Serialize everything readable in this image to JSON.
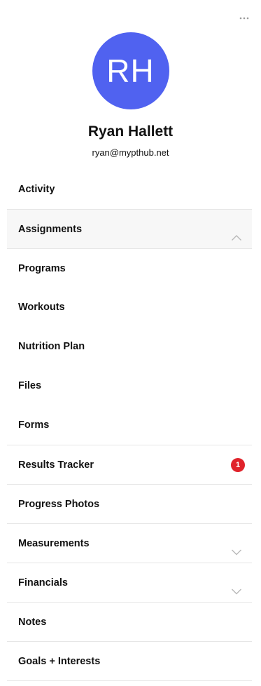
{
  "profile": {
    "initials": "RH",
    "name": "Ryan Hallett",
    "email": "ryan@mypthub.net",
    "avatar_color": "#5062f0"
  },
  "icons": {
    "more": "more-horizontal-icon",
    "chevron_up": "chevron-up-icon",
    "chevron_down": "chevron-down-icon"
  },
  "menu": {
    "items": [
      {
        "label": "Activity"
      },
      {
        "label": "Assignments",
        "expanded": true
      },
      {
        "label": "Programs"
      },
      {
        "label": "Workouts"
      },
      {
        "label": "Nutrition Plan"
      },
      {
        "label": "Files"
      },
      {
        "label": "Forms"
      },
      {
        "label": "Results Tracker",
        "badge": "1"
      },
      {
        "label": "Progress Photos"
      },
      {
        "label": "Measurements",
        "expandable": true
      },
      {
        "label": "Financials",
        "expandable": true
      },
      {
        "label": "Notes"
      },
      {
        "label": "Goals + Interests"
      }
    ]
  },
  "colors": {
    "badge": "#e0232b",
    "active_row": "#f7f7f7",
    "divider": "#e6e6e6"
  }
}
